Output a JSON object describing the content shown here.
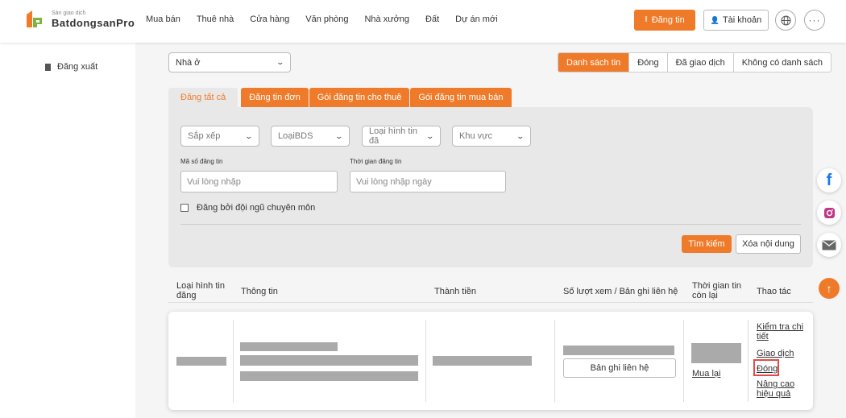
{
  "header": {
    "logo_small": "Sàn giao dịch",
    "logo_big": "BatdongsanPro",
    "nav": [
      "Mua bán",
      "Thuê nhà",
      "Cửa hàng",
      "Văn phòng",
      "Nhà xưởng",
      "Đất",
      "Dự án mới"
    ],
    "post_button": "Đăng tin",
    "account_button": "Tài khoản",
    "accent_color": "#ef7b2a"
  },
  "sidebar": {
    "logout_label": "Đăng xuất"
  },
  "main": {
    "property_type_select": "Nhà ở",
    "list_tabs": [
      "Danh sách tin",
      "Đóng",
      "Đã giao dịch",
      "Không có danh sách"
    ],
    "post_tabs": [
      "Đăng tất cả",
      "Đăng tin đơn",
      "Gói đăng tin cho thuê",
      "Gói đăng tin mua bán"
    ],
    "filters": {
      "sort": "Sắp xếp",
      "property_type": "LoạiBDS",
      "post_type": "Loại hình tin đă",
      "area": "Khu vực",
      "post_id_label": "Mã số đăng tin",
      "post_id_placeholder": "Vui lòng nhập",
      "post_time_label": "Thời gian đăng tin",
      "post_time_placeholder": "Vui lòng nhập ngày",
      "pro_team_label": "Đăng bởi đội ngũ chuyên môn",
      "search_button": "Tìm kiếm",
      "clear_button": "Xóa nội dung"
    },
    "table": {
      "headers": [
        "Loại hình tin đăng",
        "Thông tin",
        "Thành tiền",
        "Số lượt xem / Bản ghi liên hệ",
        "Thời gian tin còn lại",
        "Thao tác"
      ],
      "contact_button": "Bản ghi liên hệ",
      "rebuy_link": "Mua lại",
      "actions": [
        "Kiểm tra chi tiết",
        "Giao dịch",
        "Đóng",
        "Nâng cao hiệu quả"
      ]
    }
  }
}
